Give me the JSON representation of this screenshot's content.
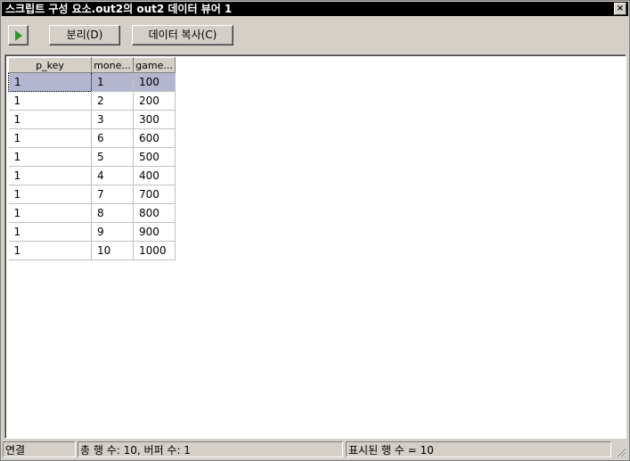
{
  "window": {
    "title": "스크립트 구성 요소.out2의 out2 데이터 뷰어 1",
    "close_glyph": "×"
  },
  "toolbar": {
    "run_icon": "play-icon",
    "detach_label": "분리(D)",
    "copy_label": "데이터 복사(C)"
  },
  "grid": {
    "columns": [
      "p_key",
      "mone...",
      "game..."
    ],
    "rows": [
      [
        "1",
        "1",
        "100"
      ],
      [
        "1",
        "2",
        "200"
      ],
      [
        "1",
        "3",
        "300"
      ],
      [
        "1",
        "6",
        "600"
      ],
      [
        "1",
        "5",
        "500"
      ],
      [
        "1",
        "4",
        "400"
      ],
      [
        "1",
        "7",
        "700"
      ],
      [
        "1",
        "8",
        "800"
      ],
      [
        "1",
        "9",
        "900"
      ],
      [
        "1",
        "10",
        "1000"
      ]
    ]
  },
  "status": {
    "connection": "연결",
    "totals": "총 행 수: 10, 버퍼 수: 1",
    "displayed": "표시된 행 수 = 10"
  },
  "colors": {
    "chrome": "#d4d0c8",
    "title_bg": "#000000",
    "selected_row": "#b4b6d0",
    "run_icon": "#2a9a2a"
  }
}
